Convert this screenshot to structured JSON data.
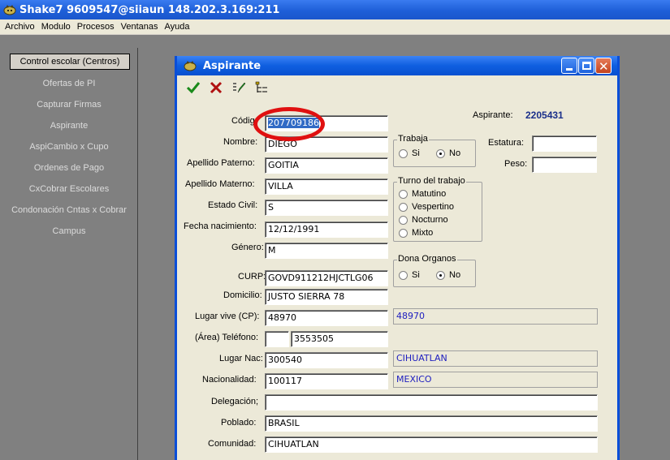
{
  "app": {
    "title": "Shake7 9609547@siiaun   148.202.3.169:211"
  },
  "menu": [
    "Archivo",
    "Modulo",
    "Procesos",
    "Ventanas",
    "Ayuda"
  ],
  "nav": {
    "header": "Control escolar (Centros)",
    "items": [
      "Ofertas de PI",
      "Capturar Firmas",
      "Aspirante",
      "AspiCambio x Cupo",
      "Ordenes de Pago",
      "CxCobrar Escolares",
      "Condonación Cntas x Cobrar",
      "Campus"
    ]
  },
  "window": {
    "title": "Aspirante",
    "toolbar_icons": [
      "checkmark-icon",
      "x-cancel-icon",
      "pencil-edit-icon",
      "list-tree-icon"
    ]
  },
  "form": {
    "aspirante_label": "Aspirante:",
    "aspirante_value": "2205431",
    "codigo_label": "Códig",
    "codigo_value": "207709186",
    "nombre_label": "Nombre:",
    "nombre_value": "DIEGO",
    "ap_paterno_label": "Apellido Paterno:",
    "ap_paterno_value": "GOITIA",
    "ap_materno_label": "Apellido Materno:",
    "ap_materno_value": "VILLA",
    "estado_civil_label": "Estado Civil:",
    "estado_civil_value": "S",
    "fecha_label": "Fecha nacimiento:",
    "fecha_value": "12/12/1991",
    "genero_label": "Género:",
    "genero_value": "M",
    "curp_label": "CURP:",
    "curp_value": "GOVD911212HJCTLG06",
    "domicilio_label": "Domicilio:",
    "domicilio_value": "JUSTO SIERRA  78",
    "lugar_vive_label": "Lugar vive (CP):",
    "lugar_vive_value": "48970",
    "lugar_vive_desc": "48970",
    "telefono_label": "(Área) Teléfono:",
    "telefono_area": "",
    "telefono_value": "3553505",
    "lugar_nac_label": "Lugar Nac:",
    "lugar_nac_value": "300540",
    "lugar_nac_desc": "CIHUATLAN",
    "nacionalidad_label": "Nacionalidad:",
    "nacionalidad_value": "100117",
    "nacionalidad_desc": "MEXICO",
    "delegacion_label": "Delegación;",
    "delegacion_value": "",
    "poblado_label": "Poblado:",
    "poblado_value": "BRASIL",
    "comunidad_label": "Comunidad:",
    "comunidad_value": "CIHUATLAN",
    "trabaja": {
      "title": "Trabaja",
      "si": "Si",
      "no": "No",
      "selected": "No"
    },
    "turno": {
      "title": "Turno del trabajo",
      "options": [
        "Matutino",
        "Vespertino",
        "Nocturno",
        "Mixto"
      ]
    },
    "dona": {
      "title": "Dona Organos",
      "si": "Si",
      "no": "No",
      "selected": "No"
    },
    "estatura_label": "Estatura:",
    "estatura_value": "",
    "peso_label": "Peso:",
    "peso_value": ""
  },
  "colors": {
    "titlebar": "#1e5fd8",
    "panel": "#808080",
    "window_bg": "#ece9d8",
    "highlight": "#e01010"
  }
}
